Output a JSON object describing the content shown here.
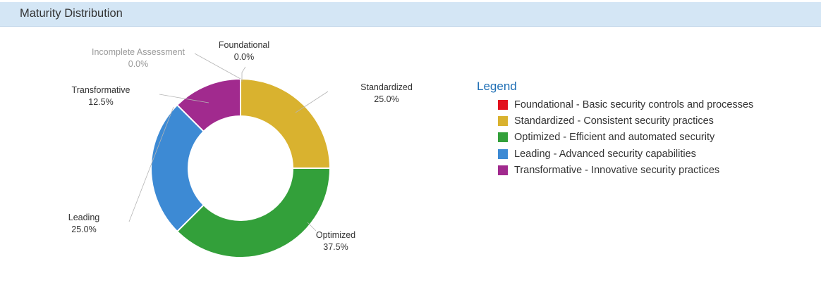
{
  "panel": {
    "title": "Maturity Distribution"
  },
  "chart_data": {
    "type": "pie",
    "variant": "donut",
    "categories": [
      "Foundational",
      "Standardized",
      "Optimized",
      "Leading",
      "Transformative",
      "Incomplete Assessment"
    ],
    "values": [
      0.0,
      25.0,
      37.5,
      25.0,
      12.5,
      0.0
    ],
    "value_labels": [
      "0.0%",
      "25.0%",
      "37.5%",
      "25.0%",
      "12.5%",
      "0.0%"
    ],
    "colors": [
      "#e2101d",
      "#d9b22f",
      "#33a03a",
      "#3d8ad4",
      "#a12a8e",
      "#b8b8b8"
    ],
    "legend_position": "right"
  },
  "legend": {
    "title": "Legend",
    "items": [
      {
        "label": "Foundational - Basic security controls and processes",
        "color": "#e2101d"
      },
      {
        "label": "Standardized - Consistent security practices",
        "color": "#d9b22f"
      },
      {
        "label": "Optimized - Efficient and automated security",
        "color": "#33a03a"
      },
      {
        "label": "Leading - Advanced security capabilities",
        "color": "#3d8ad4"
      },
      {
        "label": "Transformative  - Innovative security practices",
        "color": "#a12a8e"
      }
    ]
  }
}
